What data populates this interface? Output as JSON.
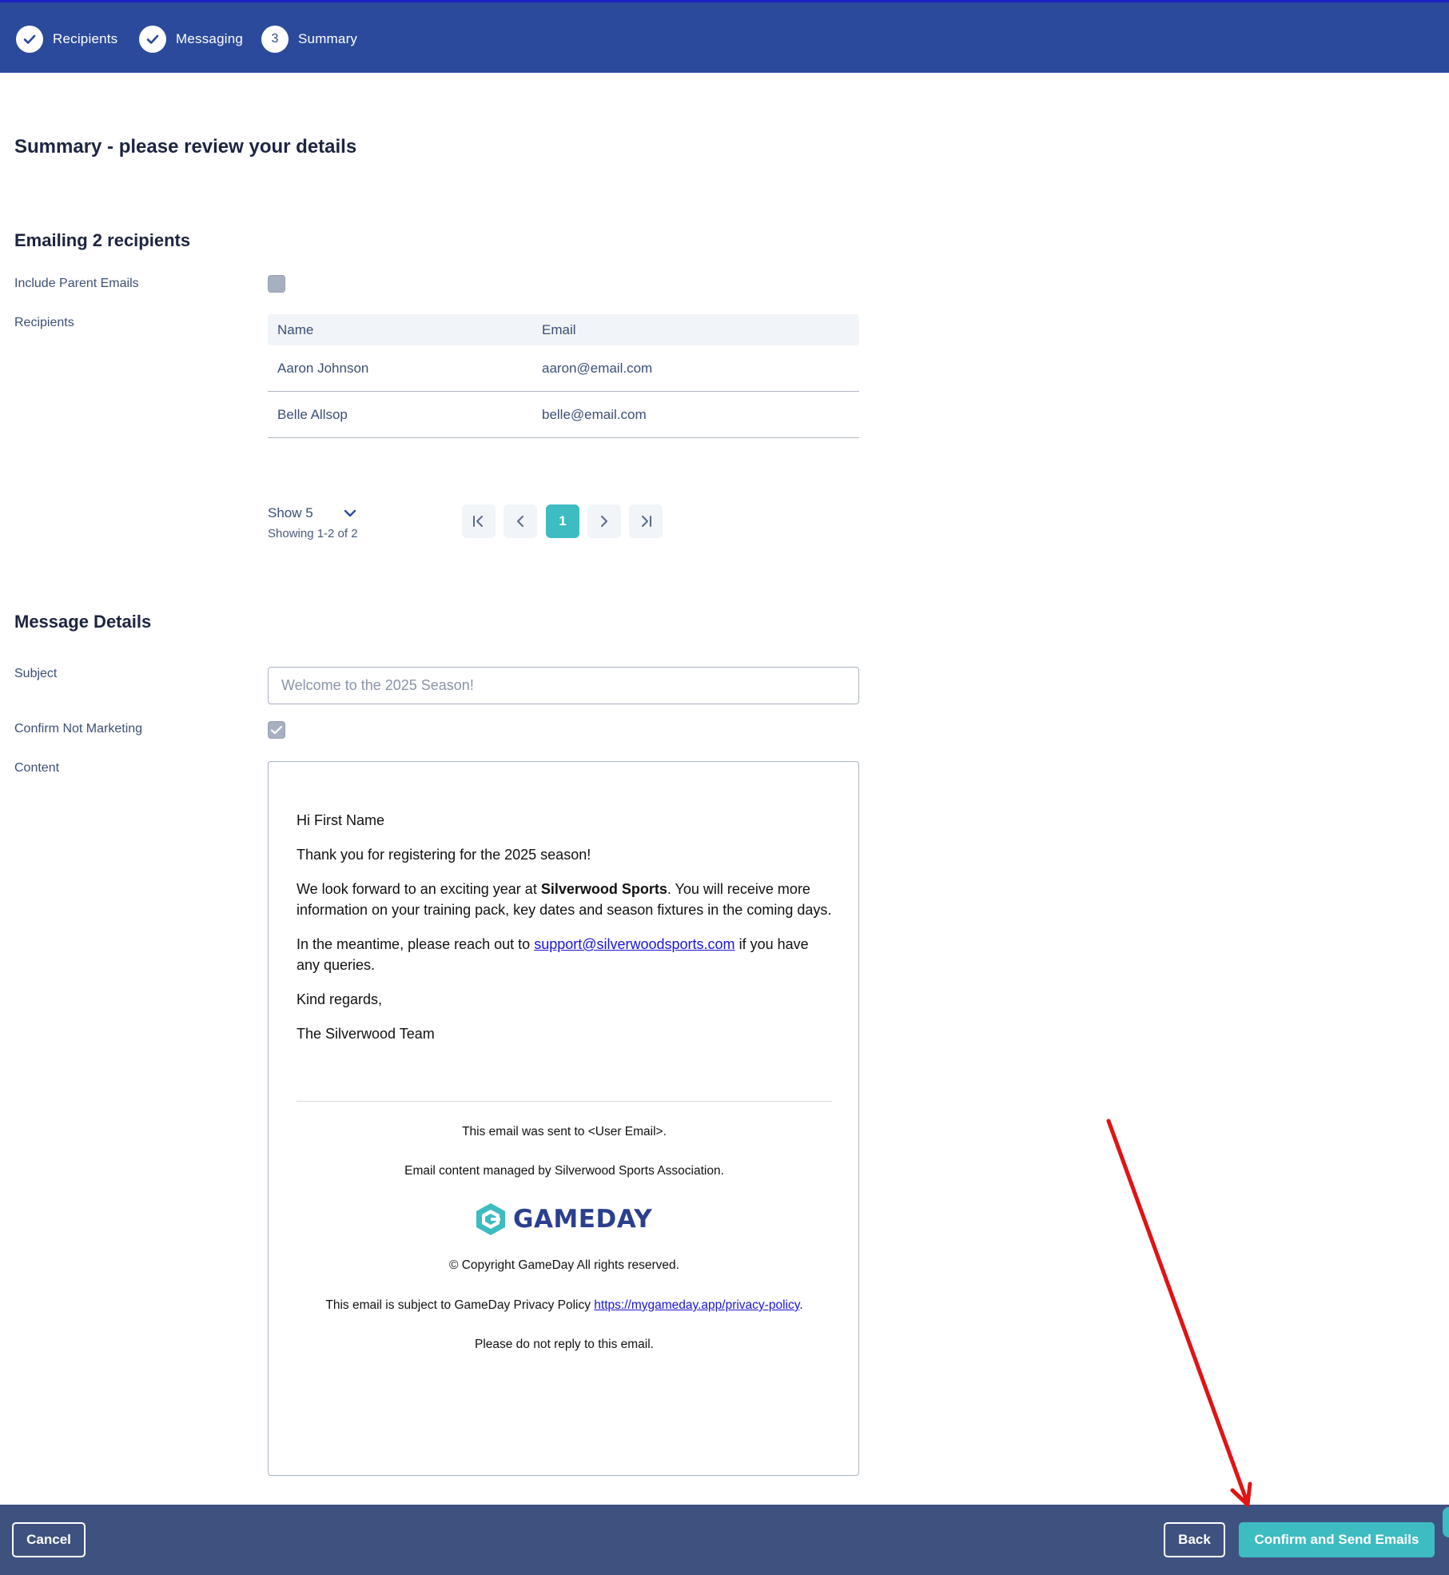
{
  "stepper": {
    "steps": [
      {
        "label": "Recipients",
        "icon": "check-icon"
      },
      {
        "label": "Messaging",
        "icon": "check-icon"
      },
      {
        "number": "3",
        "label": "Summary"
      }
    ]
  },
  "page_title": "Summary - please review your details",
  "recipients_section": {
    "title": "Emailing 2 recipients",
    "include_parent_label": "Include Parent Emails",
    "include_parent_checked": false,
    "recipients_label": "Recipients",
    "columns": [
      "Name",
      "Email"
    ],
    "rows": [
      {
        "name": "Aaron Johnson",
        "email": "aaron@email.com"
      },
      {
        "name": "Belle Allsop",
        "email": "belle@email.com"
      }
    ],
    "page_size": "Show 5",
    "showing": "Showing 1-2 of 2",
    "current_page": "1"
  },
  "message_section": {
    "title": "Message Details",
    "subject_label": "Subject",
    "subject_value": "Welcome to the 2025 Season!",
    "confirm_label": "Confirm Not Marketing",
    "confirm_checked": true,
    "content_label": "Content",
    "email": {
      "greeting": "Hi First Name",
      "para1": "Thank you for registering for the 2025 season!",
      "para2_pre": "We look forward to an exciting year at ",
      "para2_bold": "Silverwood Sports",
      "para2_post": ". You will receive more information on your training pack, key dates and season fixtures in the coming days.",
      "para3_pre": "In the meantime, please reach out to ",
      "para3_link": "support@silverwoodsports.com",
      "para3_post": " if you have any queries.",
      "closing": "Kind regards,",
      "signature": "The Silverwood Team",
      "footer_sent_to": "This email was sent to <User Email>.",
      "footer_managed": "Email content managed by Silverwood Sports Association.",
      "logo_text": "GAMEDAY",
      "footer_copyright": "© Copyright GameDay All rights reserved.",
      "footer_privacy_pre": "This email is subject to GameDay Privacy Policy ",
      "footer_privacy_link": "https://mygameday.app/privacy-policy",
      "footer_privacy_post": ".",
      "footer_noreply": "Please do not reply to this email."
    }
  },
  "footer_bar": {
    "cancel_label": "Cancel",
    "back_label": "Back",
    "confirm_label": "Confirm and Send Emails"
  },
  "colors": {
    "header_bg": "#2b4a9b",
    "accent": "#3dbcc2",
    "bottom_bar_bg": "#3e5280",
    "annotation_arrow": "#e01414"
  }
}
